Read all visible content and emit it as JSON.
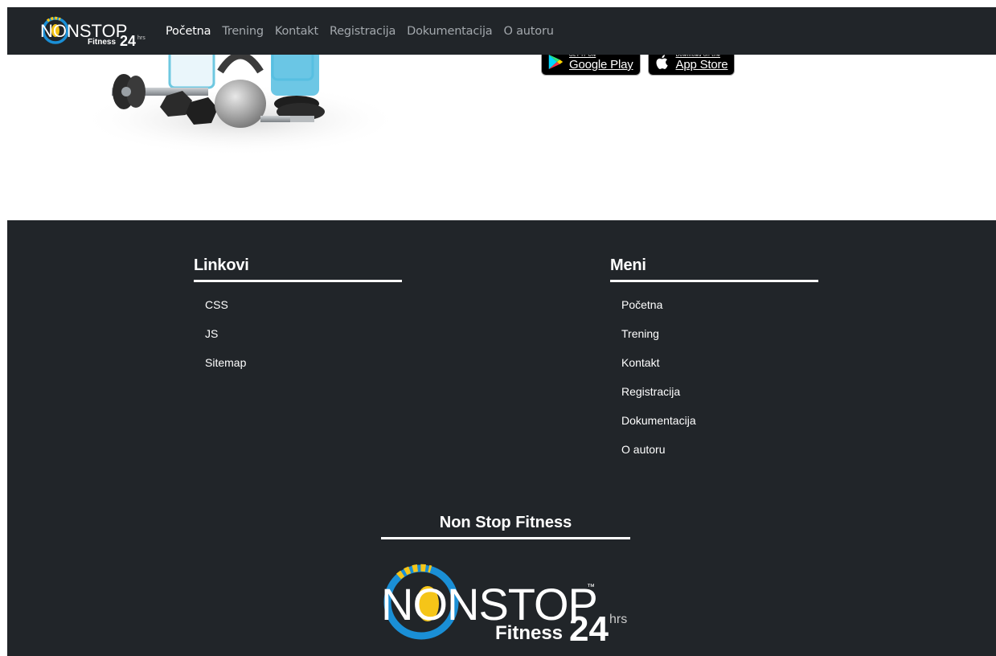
{
  "navbar": {
    "brand": {
      "word": "NONSTOP",
      "sub": "Fitness",
      "hours": "24",
      "hrs": "hrs",
      "tm": "™"
    },
    "items": [
      {
        "label": "Početna",
        "active": true
      },
      {
        "label": "Trening"
      },
      {
        "label": "Kontakt"
      },
      {
        "label": "Registracija"
      },
      {
        "label": "Dokumentacija"
      },
      {
        "label": "O autoru"
      }
    ]
  },
  "stores": {
    "google": {
      "small": "GET IT ON",
      "big": "Google Play"
    },
    "apple": {
      "small": "Download on the",
      "big": "App Store"
    }
  },
  "footer": {
    "links": {
      "title": "Linkovi",
      "items": [
        "CSS",
        "JS",
        "Sitemap"
      ]
    },
    "menu": {
      "title": "Meni",
      "items": [
        "Početna",
        "Trening",
        "Kontakt",
        "Registracija",
        "Dokumentacija",
        "O autoru"
      ]
    },
    "brand_title": "Non Stop Fitness",
    "logo": {
      "word": "NONSTOP",
      "sub": "Fitness",
      "hours": "24",
      "hrs": "hrs",
      "tm": "™"
    }
  },
  "colors": {
    "dark": "#212529",
    "accent_blue": "#1a8fd6",
    "accent_yellow": "#f5c518"
  }
}
